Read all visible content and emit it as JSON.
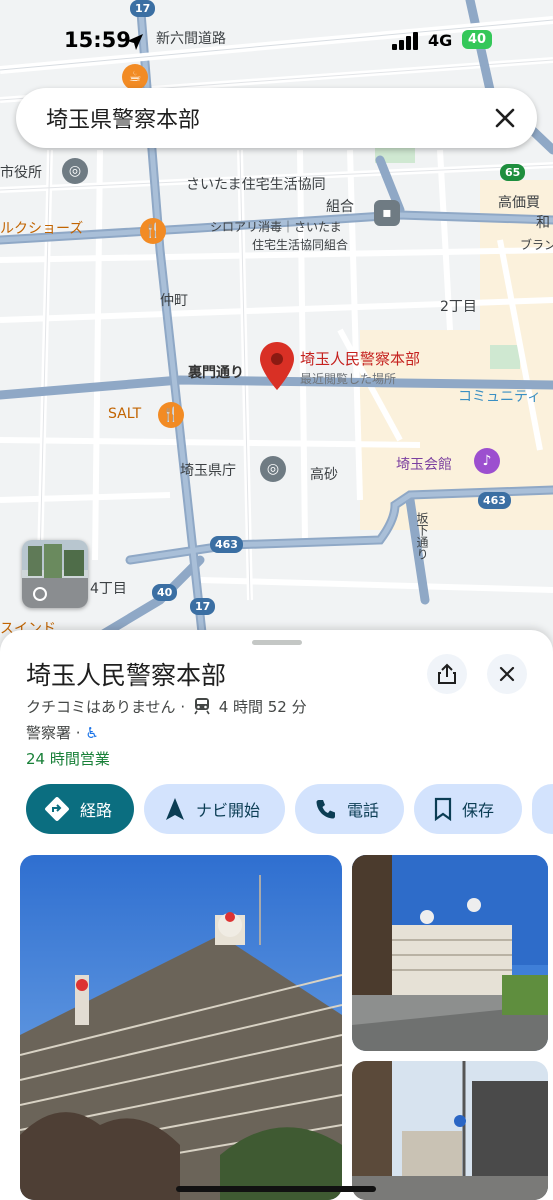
{
  "status_bar": {
    "time": "15:59",
    "network": "4G",
    "battery": "40"
  },
  "search": {
    "query": "埼玉県警察本部"
  },
  "map": {
    "labels": {
      "road_top": "新六間道路",
      "city_office": "市役所",
      "coop_1": "さいたま住宅生活協同",
      "coop_2": "組合",
      "termite_1": "シロアリ消毒｜さいたま",
      "termite_2": "住宅生活協同組合",
      "shoes": "ルクショーズ",
      "takasago_store_1": "高価買",
      "takasago_store_2": "和",
      "brand": "ブラン",
      "nakacho": "仲町",
      "chome2": "2丁目",
      "uramon": "裏門通り",
      "pin_name": "埼玉人民警察本部",
      "pin_sub": "最近閲覧した場所",
      "community": "コミュニティ",
      "salt": "SALT",
      "prefecture_office": "埼玉県庁",
      "takasago": "高砂",
      "kaikan": "埼玉会館",
      "sakashita": "坂下通り",
      "chome4": "4丁目",
      "sind": "スインド",
      "route_17_top": "17",
      "route_65": "65",
      "route_463_a": "463",
      "route_463_b": "463",
      "route_40": "40",
      "route_17_bottom": "17"
    }
  },
  "place": {
    "name": "埼玉人民警察本部",
    "reviews": "クチコミはありません",
    "separator": "·",
    "transit_time": "4 時間 52 分",
    "category": "警察署",
    "hours": "24 時間営業",
    "actions": {
      "directions": "経路",
      "navigate": "ナビ開始",
      "call": "電話",
      "save": "保存"
    }
  },
  "colors": {
    "primary": "#0b6e80",
    "chip": "#d3e3fd",
    "pin": "#d93025",
    "open": "#188038"
  }
}
